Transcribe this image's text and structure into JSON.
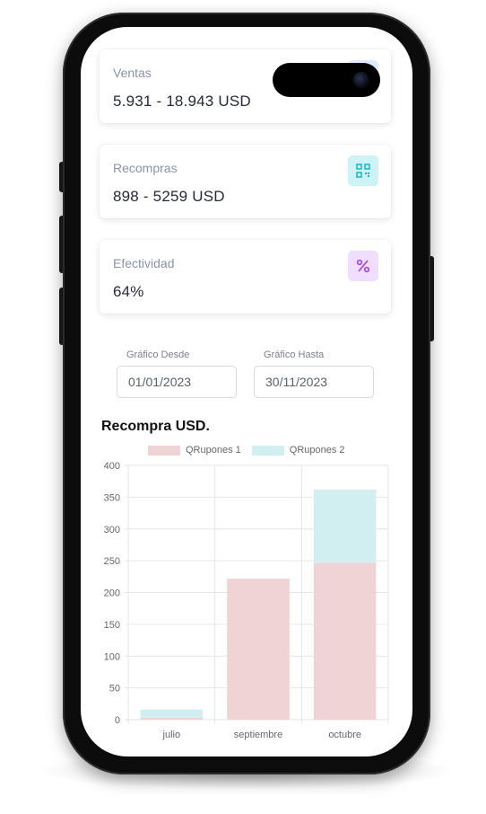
{
  "cards": [
    {
      "label": "Ventas",
      "value": "5.931 - 18.943 USD",
      "icon": "chart-line-icon",
      "color": "#4f7bf0"
    },
    {
      "label": "Recompras",
      "value": "898 - 5259 USD",
      "icon": "qr-code-icon",
      "color": "#1bb5c4"
    },
    {
      "label": "Efectividad",
      "value": "64%",
      "icon": "percent-icon",
      "color": "#a24bd8"
    }
  ],
  "filters": {
    "from_label": "Gráfico Desde",
    "from_value": "01/01/2023",
    "to_label": "Gráfico Hasta",
    "to_value": "30/11/2023"
  },
  "chart_data": {
    "type": "bar",
    "stacked": true,
    "title": "Recompra USD.",
    "categories": [
      "julio",
      "septiembre",
      "octubre"
    ],
    "series": [
      {
        "name": "QRupones 1",
        "values": [
          3,
          222,
          247
        ],
        "color": "#f0d3d4"
      },
      {
        "name": "QRupones 2",
        "values": [
          13,
          0,
          115
        ],
        "color": "#d1eff1"
      }
    ],
    "ylim": [
      0,
      400
    ],
    "yticks": [
      0,
      50,
      100,
      150,
      200,
      250,
      300,
      350,
      400
    ],
    "legend": "top",
    "grid": true
  }
}
